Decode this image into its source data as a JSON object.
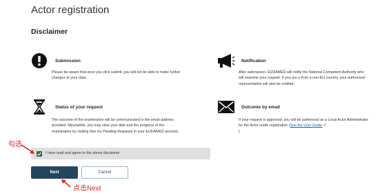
{
  "page": {
    "title": "Actor registration",
    "subtitle": "Disclaimer"
  },
  "sections": {
    "submission": {
      "icon": "exclamation-icon",
      "title": "Submission",
      "body": "Please be aware that once you click submit, you will not be able to make further changes to your data."
    },
    "notification": {
      "icon": "megaphone-icon",
      "title": "Notification",
      "body": "After submission, EUDAMED will notify the National Competent Authority who will examine your request. If you are a from a non-EU country, your authorised representative will also be notified."
    },
    "status": {
      "icon": "hourglass-icon",
      "title": "Status of your request",
      "body": "The outcome of the examination will be communicated to the email address provided. Meanwhile, you may view your date and the progress of the examination by visiting See my Pending Requests in your EUDAMED account."
    },
    "outcome": {
      "icon": "envelope-icon",
      "title": "Outcome by email",
      "body_before_link": "If your request is approved, you will be authorised as a Local Actor Administrator for the Actor under registration (",
      "link_text": "See the User Guide",
      "body_after_link": ")"
    }
  },
  "agreement": {
    "checked": true,
    "label": "I have read and agree to the above disclaimer"
  },
  "buttons": {
    "next": "Next",
    "cancel": "Cancel"
  },
  "annotations": {
    "check_hint": "勾选",
    "next_hint": "点击Next"
  },
  "colors": {
    "primary": "#24475e",
    "checkbox": "#2e6b46",
    "annotation": "#e02020",
    "link": "#1a5aa8"
  }
}
